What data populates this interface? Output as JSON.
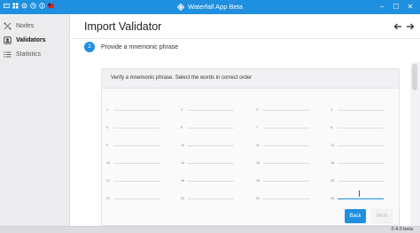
{
  "window": {
    "title": "Waterfall App Beta"
  },
  "sidebar": {
    "items": [
      {
        "label": "Nodes",
        "icon": "network-icon",
        "active": false
      },
      {
        "label": "Validators",
        "icon": "validator-icon",
        "active": true
      },
      {
        "label": "Statistics",
        "icon": "list-icon",
        "active": false
      }
    ]
  },
  "main": {
    "title": "Import Validator",
    "step": {
      "number": "2",
      "label": "Provide a mnemonic phrase"
    },
    "card": {
      "instructions": "Verify a mnemonic phrase. Select the words in correct order",
      "word_numbers": [
        "1",
        "2",
        "3",
        "4",
        "5",
        "6",
        "7",
        "8",
        "9",
        "10",
        "11",
        "12",
        "13",
        "14",
        "15",
        "16",
        "17",
        "18",
        "19",
        "20",
        "21",
        "22",
        "23",
        "24"
      ],
      "focused_index": 24
    },
    "buttons": {
      "back": "Back",
      "next": "Next"
    }
  },
  "status": {
    "version": "0.4.0 beta"
  },
  "colors": {
    "accent": "#1f8fe0",
    "sidebar_bg": "#ececee"
  }
}
